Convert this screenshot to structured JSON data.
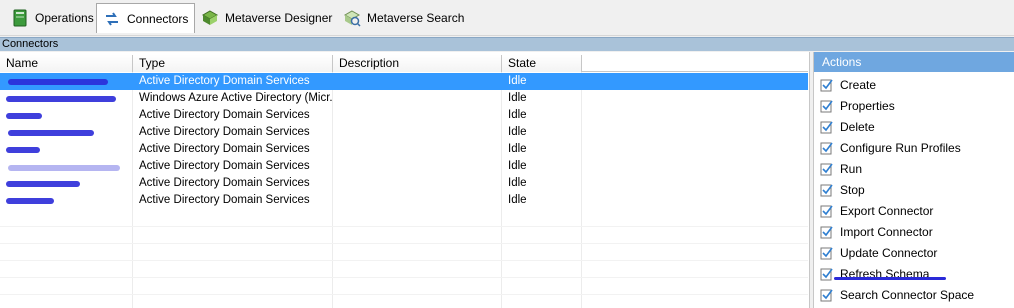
{
  "toolbar": {
    "tabs": [
      {
        "label": "Operations",
        "icon": "book-icon",
        "active": false
      },
      {
        "label": "Connectors",
        "icon": "connectors-icon",
        "active": true
      },
      {
        "label": "Metaverse Designer",
        "icon": "metaverse-designer-icon",
        "active": false
      },
      {
        "label": "Metaverse Search",
        "icon": "metaverse-search-icon",
        "active": false
      }
    ]
  },
  "section": {
    "title": "Connectors"
  },
  "grid": {
    "columns": [
      "Name",
      "Type",
      "Description",
      "State"
    ],
    "rows": [
      {
        "name": "",
        "type": "Active Directory Domain Services",
        "description": "",
        "state": "Idle",
        "selected": true
      },
      {
        "name": "",
        "type": "Windows Azure Active Directory (Micr...",
        "description": "",
        "state": "Idle",
        "selected": false
      },
      {
        "name": "",
        "type": "Active Directory Domain Services",
        "description": "",
        "state": "Idle",
        "selected": false
      },
      {
        "name": "",
        "type": "Active Directory Domain Services",
        "description": "",
        "state": "Idle",
        "selected": false
      },
      {
        "name": "",
        "type": "Active Directory Domain Services",
        "description": "",
        "state": "Idle",
        "selected": false
      },
      {
        "name": "",
        "type": "Active Directory Domain Services",
        "description": "",
        "state": "Idle",
        "selected": false
      },
      {
        "name": "",
        "type": "Active Directory Domain Services",
        "description": "",
        "state": "Idle",
        "selected": false
      },
      {
        "name": "",
        "type": "Active Directory Domain Services",
        "description": "",
        "state": "Idle",
        "selected": false
      }
    ]
  },
  "actions": {
    "title": "Actions",
    "items": [
      "Create",
      "Properties",
      "Delete",
      "Configure Run Profiles",
      "Run",
      "Stop",
      "Export Connector",
      "Import Connector",
      "Update Connector",
      "Refresh Schema",
      "Search Connector Space"
    ]
  },
  "colors": {
    "selection": "#3399ff",
    "actions_header": "#6fa7e0",
    "section_bar": "#a9c2d9",
    "redaction": "#2a2ad8"
  }
}
